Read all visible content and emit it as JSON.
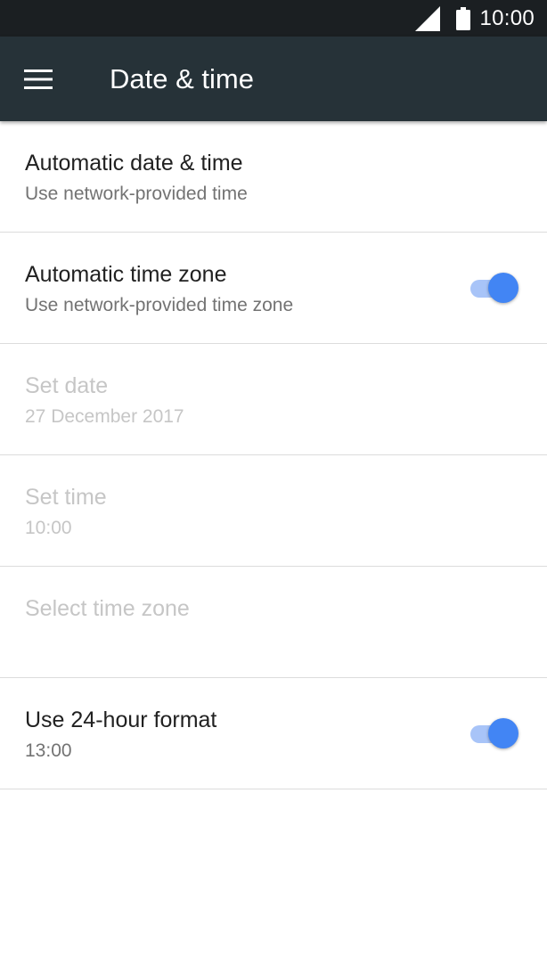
{
  "status_bar": {
    "time": "10:00",
    "signal_icon": "cell-signal-icon",
    "battery_icon": "battery-full-icon"
  },
  "app_bar": {
    "menu_icon": "hamburger-menu-icon",
    "title": "Date & time"
  },
  "colors": {
    "status_bar": "#1b1f22",
    "app_bar": "#263238",
    "accent": "#4285f4",
    "switch_track": "#a8c4f8",
    "disabled_text": "#c6c6c6"
  },
  "settings": [
    {
      "title": "Automatic date & time",
      "summary": "Use network-provided time",
      "enabled": true,
      "toggle": null
    },
    {
      "title": "Automatic time zone",
      "summary": "Use network-provided time zone",
      "enabled": true,
      "toggle": "on"
    },
    {
      "title": "Set date",
      "summary": "27 December 2017",
      "enabled": false,
      "toggle": null
    },
    {
      "title": "Set time",
      "summary": "10:00",
      "enabled": false,
      "toggle": null
    },
    {
      "title": "Select time zone",
      "summary": "",
      "enabled": false,
      "toggle": null
    },
    {
      "title": "Use 24-hour format",
      "summary": "13:00",
      "enabled": true,
      "toggle": "on"
    }
  ]
}
